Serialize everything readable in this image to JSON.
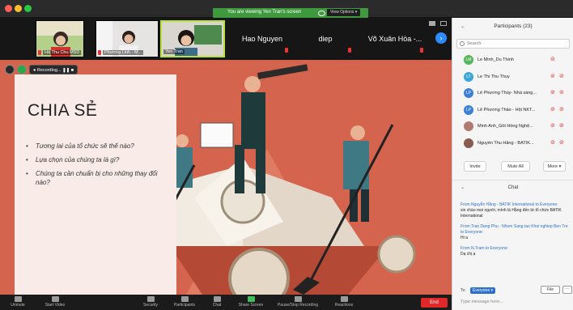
{
  "titlebar": {
    "viewing_text": "You are viewing Yen Tran's screen",
    "view_options": "View Options ▾"
  },
  "strip": {
    "thumbs": [
      {
        "name": "Hà Thu Chu MSD"
      },
      {
        "name": "Phương Linh - M..."
      },
      {
        "name": "Yen Tran"
      }
    ],
    "tiles": [
      {
        "name": "Hao Nguyen"
      },
      {
        "name": "diep"
      },
      {
        "name": "Võ Xuân Hòa -..."
      }
    ],
    "next_label": "›"
  },
  "stage": {
    "recording_label": "Recording...",
    "slide": {
      "title": "CHIA SẺ",
      "bullets": [
        "Tương lai của tổ chức sẽ thế nào?",
        "Lựa chọn của chúng ta là gì?",
        "Chúng ta cần chuẩn bị cho những thay đổi nào?"
      ]
    }
  },
  "toolbar": {
    "items": [
      "Unmute",
      "Start Video",
      "Security",
      "Participants",
      "Chat",
      "Share Screen",
      "Pause/Stop Recording",
      "Reactions"
    ],
    "participants_count": "23",
    "end_label": "End"
  },
  "panel": {
    "title": "Participants (23)",
    "search_placeholder": "Search",
    "participants": [
      {
        "initials": "LM",
        "name": "Le Minh_Du Thinh",
        "color": "#57b65a"
      },
      {
        "initials": "LT",
        "name": "Le Thi Thu Thuy",
        "color": "#3aa6d8"
      },
      {
        "initials": "LP",
        "name": "Lê Phương Thủy- Nhà sáng...",
        "color": "#3a7fd8"
      },
      {
        "initials": "LP",
        "name": "Lê Phương Thảo - Hội NKT...",
        "color": "#3a7fd8"
      },
      {
        "initials": "",
        "name": "Minh Anh_Gốt Hồng Nghệ...",
        "color": "#b07a6e"
      },
      {
        "initials": "",
        "name": "Nguyễn Thu Hằng - BATIK...",
        "color": "#8a5a4e"
      }
    ],
    "invite_label": "Invite",
    "mute_all_label": "Mute All",
    "more_label": "More ▾",
    "chat_title": "Chat",
    "messages": [
      {
        "from": "From Nguyễn Hằng - BATIK International to Everyone:",
        "text": "xin chào mọi người, mình là Hằng đến từ tổ chức BATIK International"
      },
      {
        "from": "From Tran Dang Phu - Nhom Sang tao Khoi nghiep Ben Tre to Everyone:",
        "text": "Hi a"
      },
      {
        "from": "From N.Tram to Everyone:",
        "text": "Dạ chị ạ"
      }
    ],
    "to_label": "To:",
    "to_value": "Everyone ▾",
    "file_label": "File",
    "more_dots": "···",
    "type_placeholder": "Type message here..."
  }
}
